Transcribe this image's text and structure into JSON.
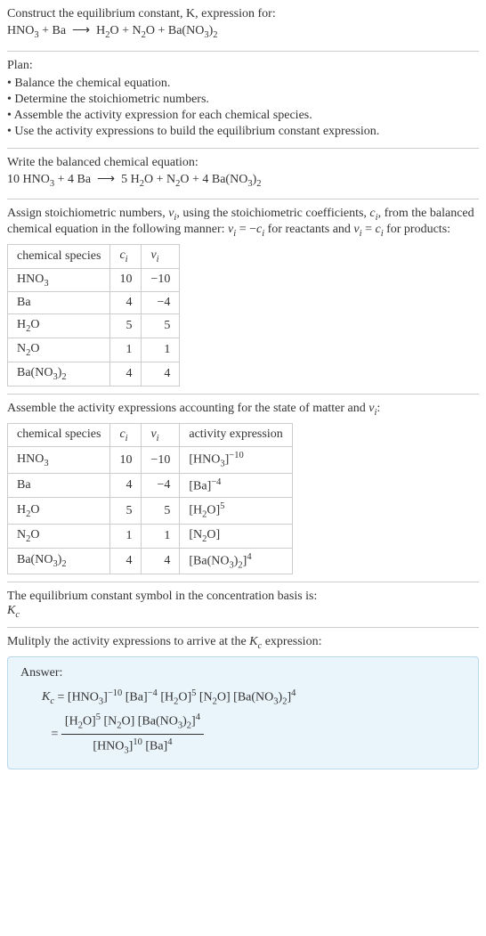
{
  "prompt": {
    "line1": "Construct the equilibrium constant, K, expression for:",
    "equation": "HNO₃ + Ba ⟶ H₂O + N₂O + Ba(NO₃)₂"
  },
  "plan": {
    "heading": "Plan:",
    "items": [
      "Balance the chemical equation.",
      "Determine the stoichiometric numbers.",
      "Assemble the activity expression for each chemical species.",
      "Use the activity expressions to build the equilibrium constant expression."
    ]
  },
  "balanced": {
    "heading": "Write the balanced chemical equation:",
    "equation": "10 HNO₃ + 4 Ba ⟶ 5 H₂O + N₂O + 4 Ba(NO₃)₂"
  },
  "stoich": {
    "text": "Assign stoichiometric numbers, νᵢ, using the stoichiometric coefficients, cᵢ, from the balanced chemical equation in the following manner: νᵢ = −cᵢ for reactants and νᵢ = cᵢ for products:",
    "headers": {
      "species": "chemical species",
      "c": "cᵢ",
      "v": "νᵢ"
    },
    "rows": [
      {
        "species": "HNO₃",
        "c": "10",
        "v": "−10"
      },
      {
        "species": "Ba",
        "c": "4",
        "v": "−4"
      },
      {
        "species": "H₂O",
        "c": "5",
        "v": "5"
      },
      {
        "species": "N₂O",
        "c": "1",
        "v": "1"
      },
      {
        "species": "Ba(NO₃)₂",
        "c": "4",
        "v": "4"
      }
    ]
  },
  "activity": {
    "heading": "Assemble the activity expressions accounting for the state of matter and νᵢ:",
    "headers": {
      "species": "chemical species",
      "c": "cᵢ",
      "v": "νᵢ",
      "act": "activity expression"
    },
    "rows": [
      {
        "species": "HNO₃",
        "c": "10",
        "v": "−10",
        "act": "[HNO₃]⁻¹⁰"
      },
      {
        "species": "Ba",
        "c": "4",
        "v": "−4",
        "act": "[Ba]⁻⁴"
      },
      {
        "species": "H₂O",
        "c": "5",
        "v": "5",
        "act": "[H₂O]⁵"
      },
      {
        "species": "N₂O",
        "c": "1",
        "v": "1",
        "act": "[N₂O]"
      },
      {
        "species": "Ba(NO₃)₂",
        "c": "4",
        "v": "4",
        "act": "[Ba(NO₃)₂]⁴"
      }
    ]
  },
  "symbol": {
    "line1": "The equilibrium constant symbol in the concentration basis is:",
    "line2": "K_c"
  },
  "multiply": "Mulitply the activity expressions to arrive at the K_c expression:",
  "answer": {
    "label": "Answer:",
    "line1": "K_c = [HNO₃]⁻¹⁰ [Ba]⁻⁴ [H₂O]⁵ [N₂O] [Ba(NO₃)₂]⁴",
    "frac_num": "[H₂O]⁵ [N₂O] [Ba(NO₃)₂]⁴",
    "frac_den": "[HNO₃]¹⁰ [Ba]⁴"
  }
}
